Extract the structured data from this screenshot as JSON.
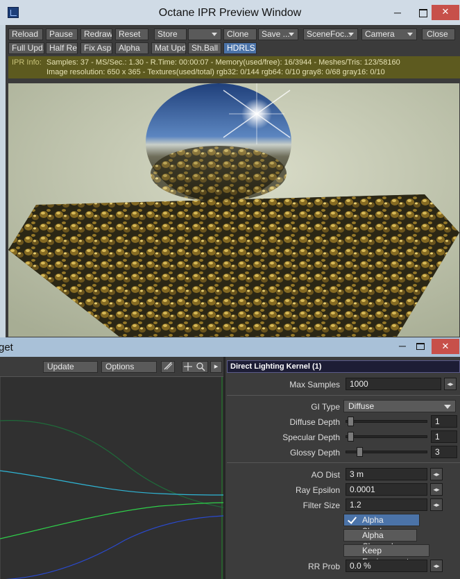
{
  "ipr_window": {
    "title": "Octane IPR Preview Window",
    "toolbar_row1": [
      "Reload",
      "Pause",
      "Redraw",
      "Reset",
      "Store",
      "",
      "Clone",
      "Save ...",
      "SceneFoc...",
      "Camera",
      "Close"
    ],
    "toolbar_row2": [
      "Full Upd.",
      "Half Res",
      "Fix Asp.",
      "Alpha",
      "Mat Upd",
      "Sh.Ball",
      "HDRLS"
    ],
    "info_label": "IPR Info:",
    "info_line1": "Samples: 37  -  MS/Sec.: 1.30  -  R.Time: 00:00:07 - Memory(used/free): 16/3944  -  Meshes/Tris: 123/58160",
    "info_line2": "Image resolution: 650 x 365 - Textures(used/total) rgb32: 0/144   rgb64: 0/10   gray8: 0/68   gray16: 0/10"
  },
  "bottom_window": {
    "title": "get",
    "update_label": "Update",
    "options_label": "Options",
    "panel_title": "Direct Lighting Kernel (1)",
    "max_samples_label": "Max Samples",
    "max_samples_value": "1000",
    "gi_type_label": "GI Type",
    "gi_type_value": "Diffuse",
    "diffuse_depth_label": "Diffuse Depth",
    "diffuse_depth_value": "1",
    "specular_depth_label": "Specular Depth",
    "specular_depth_value": "1",
    "glossy_depth_label": "Glossy Depth",
    "glossy_depth_value": "3",
    "ao_dist_label": "AO Dist",
    "ao_dist_value": "3 m",
    "ray_epsilon_label": "Ray Epsilon",
    "ray_epsilon_value": "0.0001",
    "filter_size_label": "Filter Size",
    "filter_size_value": "1.2",
    "alpha_shadows_label": "Alpha Shadows",
    "alpha_channel_label": "Alpha Channel",
    "keep_environment_label": "Keep Environment",
    "rr_prob_label": "RR Prob",
    "rr_prob_value": "0.0 %"
  },
  "icons": {
    "minimize": "─",
    "close": "✕",
    "stepper": "◂▸",
    "play": "▸"
  },
  "colors": {
    "active_button": "#4b73a8",
    "info_bar": "#5d5a1f",
    "close_button": "#c7504a"
  }
}
